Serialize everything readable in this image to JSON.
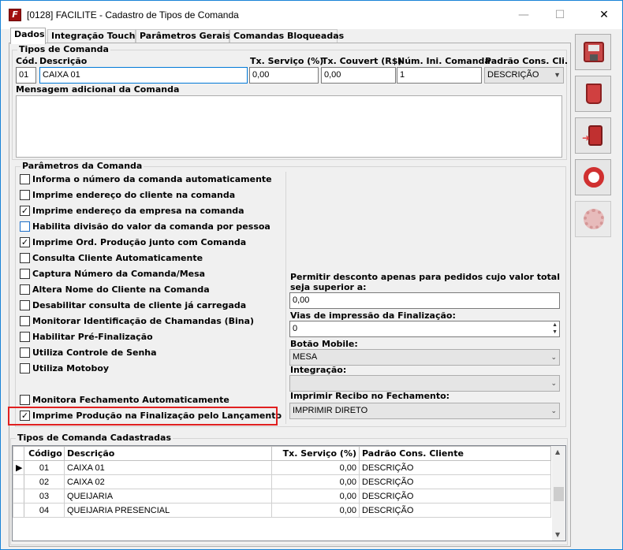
{
  "window": {
    "title": "[0128] FACILITE - Cadastro de Tipos de Comanda",
    "icon": "F",
    "min": "—",
    "max": "☐",
    "close": "✕"
  },
  "tabs": [
    {
      "label": "Dados"
    },
    {
      "label": "Integração Touch"
    },
    {
      "label": "Parâmetros Gerais"
    },
    {
      "label": "Comandas Bloqueadas"
    }
  ],
  "tipos": {
    "group_label": "Tipos de Comanda",
    "cod_label": "Cód.",
    "desc_label": "Descrição",
    "tx_servico_label": "Tx. Serviço (%)",
    "tx_couvert_label": "Tx. Couvert (R$)",
    "num_ini_label": "Núm. Ini. Comanda",
    "padrao_label": "Padrão Cons. Cli.",
    "cod": "01",
    "descricao": "CAIXA 01",
    "tx_servico": "0,00",
    "tx_couvert": "0,00",
    "num_ini": "1",
    "padrao": "DESCRIÇÃO",
    "mensagem_label": "Mensagem adicional da Comanda"
  },
  "parametros": {
    "group_label": "Parâmetros da Comanda",
    "checks": [
      {
        "label": "Informa o número da comanda automaticamente",
        "checked": false
      },
      {
        "label": "Imprime endereço do cliente na comanda",
        "checked": false
      },
      {
        "label": "Imprime endereço da empresa na comanda",
        "checked": true
      },
      {
        "label": "Habilita divisão do valor da comanda por pessoa",
        "checked": false
      },
      {
        "label": "Imprime Ord. Produção junto com Comanda",
        "checked": true
      },
      {
        "label": "Consulta Cliente Automaticamente",
        "checked": false
      },
      {
        "label": "Captura Número da Comanda/Mesa",
        "checked": false
      },
      {
        "label": "Altera Nome do Cliente na Comanda",
        "checked": false
      },
      {
        "label": "Desabilitar consulta de cliente já carregada",
        "checked": false
      },
      {
        "label": "Monitorar Identificação de Chamandas (Bina)",
        "checked": false
      },
      {
        "label": "Habilitar Pré-Finalização",
        "checked": false
      },
      {
        "label": "Utiliza Controle de Senha",
        "checked": false
      },
      {
        "label": "Utiliza Motoboy",
        "checked": false
      },
      {
        "label": "Monitora Fechamento Automaticamente",
        "checked": false
      },
      {
        "label": "Imprime Produção na Finalização pelo Lançamento",
        "checked": true
      }
    ],
    "desconto_label_1": "Permitir desconto apenas para pedidos cujo valor total",
    "desconto_label_2": "seja superior a:",
    "desconto_value": "0,00",
    "vias_label": "Vias de impressão da Finalização:",
    "vias_value": "0",
    "botao_mobile_label": "Botão Mobile:",
    "botao_mobile_value": "MESA",
    "integracao_label": "Integração:",
    "integracao_value": "",
    "recibo_label": "Imprimir Recibo no Fechamento:",
    "recibo_value": "IMPRIMIR DIRETO"
  },
  "cadastradas": {
    "group_label": "Tipos de Comanda Cadastradas",
    "columns": [
      "Código",
      "Descrição",
      "Tx. Serviço (%)",
      "Padrão Cons. Cliente"
    ],
    "rows": [
      {
        "codigo": "01",
        "descricao": "CAIXA 01",
        "tx": "0,00",
        "padrao": "DESCRIÇÃO"
      },
      {
        "codigo": "02",
        "descricao": "CAIXA 02",
        "tx": "0,00",
        "padrao": "DESCRIÇÃO"
      },
      {
        "codigo": "03",
        "descricao": "QUEIJARIA",
        "tx": "0,00",
        "padrao": "DESCRIÇÃO"
      },
      {
        "codigo": "04",
        "descricao": "QUEIJARIA PRESENCIAL",
        "tx": "0,00",
        "padrao": "DESCRIÇÃO"
      }
    ]
  },
  "side_buttons": {
    "save_icon": "save-icon",
    "delete_icon": "trash-icon",
    "exit_icon": "exit-door-icon",
    "help_icon": "lifebuoy-icon",
    "settings_icon": "gear-icon"
  },
  "colors": {
    "accent": "#0078d7",
    "highlight": "#e02020"
  }
}
